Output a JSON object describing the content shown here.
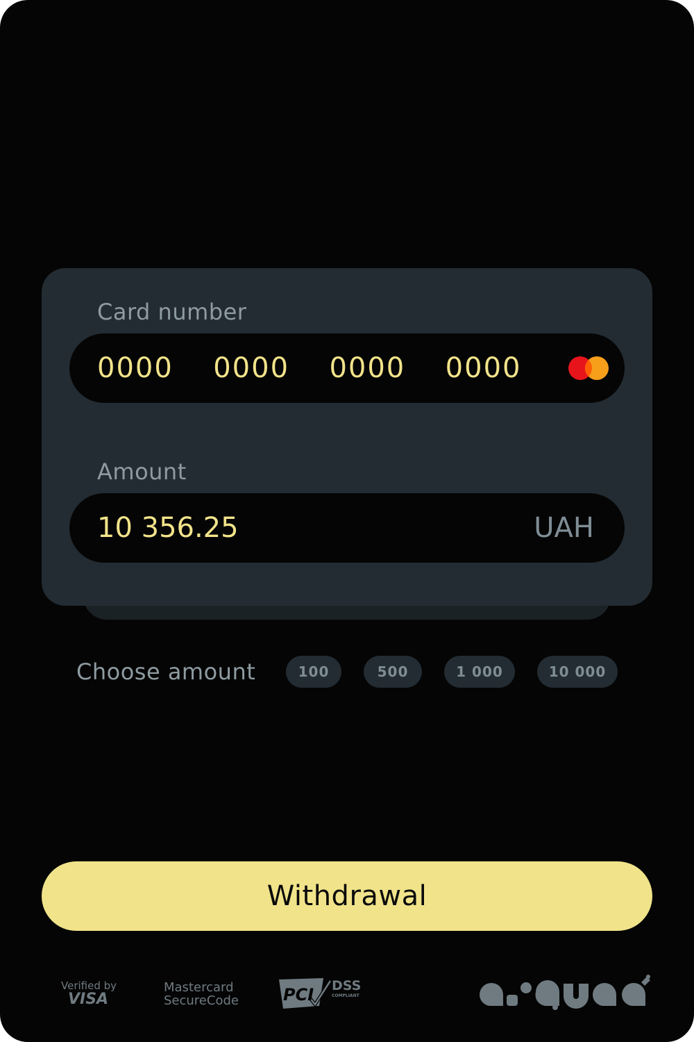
{
  "form": {
    "card_label": "Card number",
    "card_number": "0000  0000  0000  0000",
    "amount_label": "Amount",
    "amount_value": "10 356.25",
    "currency": "UAH"
  },
  "choose_amount": {
    "label": "Choose amount",
    "options": [
      "100",
      "500",
      "1 000",
      "10 000"
    ]
  },
  "withdraw_label": "Withdrawal",
  "footer": {
    "visa_top": "Verified by",
    "visa_brand": "VISA",
    "mastercard_line1": "Mastercard",
    "mastercard_line2": "SecureCode",
    "pci_text": "PCI",
    "pci_dss": "DSS",
    "pci_compliant": "COMPLIANT",
    "brand_logo": "a-squad logo"
  },
  "colors": {
    "background": "#050505",
    "panel": "#232c32",
    "accent": "#f0e38a",
    "muted": "#8e9ba1"
  }
}
